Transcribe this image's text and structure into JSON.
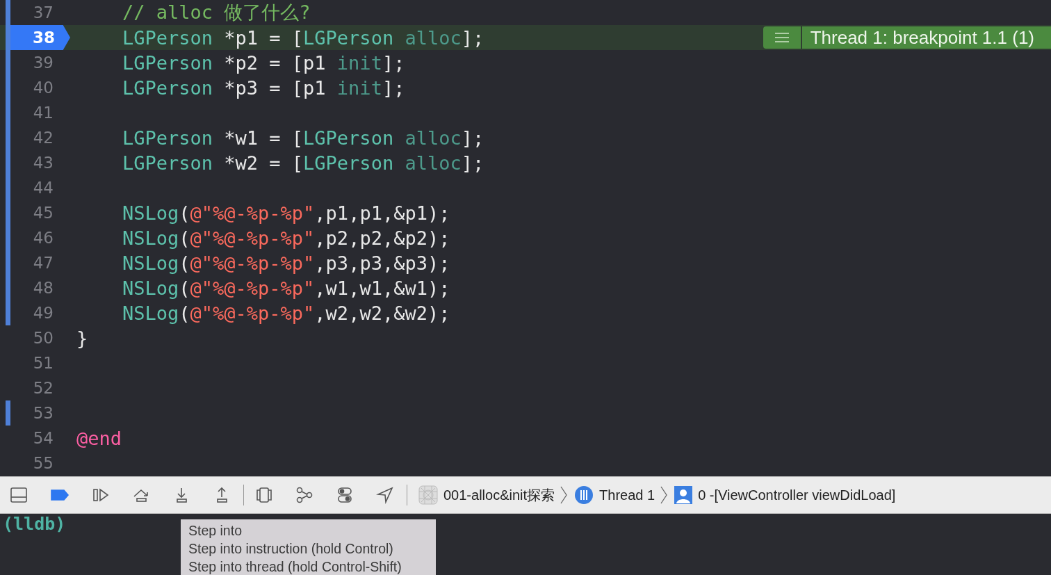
{
  "editor": {
    "lines": [
      {
        "number": "37",
        "current": false,
        "changed": true,
        "indented": true,
        "tokens": [
          {
            "kind": "comment",
            "text": "// alloc 做了什么?"
          }
        ]
      },
      {
        "number": "38",
        "current": true,
        "changed": true,
        "indented": true,
        "tokens": [
          {
            "kind": "type",
            "text": "LGPerson"
          },
          {
            "kind": "plain",
            "text": " *p1 = ["
          },
          {
            "kind": "type",
            "text": "LGPerson"
          },
          {
            "kind": "method",
            "text": " alloc"
          },
          {
            "kind": "plain",
            "text": "];"
          }
        ]
      },
      {
        "number": "39",
        "current": false,
        "changed": true,
        "indented": true,
        "tokens": [
          {
            "kind": "type",
            "text": "LGPerson"
          },
          {
            "kind": "plain",
            "text": " *p2 = [p1 "
          },
          {
            "kind": "method",
            "text": "init"
          },
          {
            "kind": "plain",
            "text": "];"
          }
        ]
      },
      {
        "number": "40",
        "current": false,
        "changed": true,
        "indented": true,
        "tokens": [
          {
            "kind": "type",
            "text": "LGPerson"
          },
          {
            "kind": "plain",
            "text": " *p3 = [p1 "
          },
          {
            "kind": "method",
            "text": "init"
          },
          {
            "kind": "plain",
            "text": "];"
          }
        ]
      },
      {
        "number": "41",
        "current": false,
        "changed": true
      },
      {
        "number": "42",
        "current": false,
        "changed": true,
        "indented": true,
        "tokens": [
          {
            "kind": "type",
            "text": "LGPerson"
          },
          {
            "kind": "plain",
            "text": " *w1 = ["
          },
          {
            "kind": "type",
            "text": "LGPerson"
          },
          {
            "kind": "method",
            "text": " alloc"
          },
          {
            "kind": "plain",
            "text": "];"
          }
        ]
      },
      {
        "number": "43",
        "current": false,
        "changed": true,
        "indented": true,
        "tokens": [
          {
            "kind": "type",
            "text": "LGPerson"
          },
          {
            "kind": "plain",
            "text": " *w2 = ["
          },
          {
            "kind": "type",
            "text": "LGPerson"
          },
          {
            "kind": "method",
            "text": " alloc"
          },
          {
            "kind": "plain",
            "text": "];"
          }
        ]
      },
      {
        "number": "44",
        "current": false,
        "changed": true
      },
      {
        "number": "45",
        "current": false,
        "changed": true,
        "indented": true,
        "tokens": [
          {
            "kind": "type",
            "text": "NSLog"
          },
          {
            "kind": "plain",
            "text": "("
          },
          {
            "kind": "string",
            "text": "@\"%@-%p-%p\""
          },
          {
            "kind": "plain",
            "text": ",p1,p1,&p1);"
          }
        ]
      },
      {
        "number": "46",
        "current": false,
        "changed": true,
        "indented": true,
        "tokens": [
          {
            "kind": "type",
            "text": "NSLog"
          },
          {
            "kind": "plain",
            "text": "("
          },
          {
            "kind": "string",
            "text": "@\"%@-%p-%p\""
          },
          {
            "kind": "plain",
            "text": ",p2,p2,&p2);"
          }
        ]
      },
      {
        "number": "47",
        "current": false,
        "changed": true,
        "indented": true,
        "tokens": [
          {
            "kind": "type",
            "text": "NSLog"
          },
          {
            "kind": "plain",
            "text": "("
          },
          {
            "kind": "string",
            "text": "@\"%@-%p-%p\""
          },
          {
            "kind": "plain",
            "text": ",p3,p3,&p3);"
          }
        ]
      },
      {
        "number": "48",
        "current": false,
        "changed": true,
        "indented": true,
        "tokens": [
          {
            "kind": "type",
            "text": "NSLog"
          },
          {
            "kind": "plain",
            "text": "("
          },
          {
            "kind": "string",
            "text": "@\"%@-%p-%p\""
          },
          {
            "kind": "plain",
            "text": ",w1,w1,&w1);"
          }
        ]
      },
      {
        "number": "49",
        "current": false,
        "changed": true,
        "indented": true,
        "tokens": [
          {
            "kind": "type",
            "text": "NSLog"
          },
          {
            "kind": "plain",
            "text": "("
          },
          {
            "kind": "string",
            "text": "@\"%@-%p-%p\""
          },
          {
            "kind": "plain",
            "text": ",w2,w2,&w2);"
          }
        ]
      },
      {
        "number": "50",
        "current": false,
        "changed": false,
        "indented": false,
        "tokens": [
          {
            "kind": "plain",
            "text": "}"
          }
        ]
      },
      {
        "number": "51",
        "current": false,
        "changed": false
      },
      {
        "number": "52",
        "current": false,
        "changed": false
      },
      {
        "number": "53",
        "current": false,
        "changed": true
      },
      {
        "number": "54",
        "current": false,
        "changed": false,
        "indented": false,
        "tokens": [
          {
            "kind": "keyword",
            "text": "@end"
          }
        ]
      },
      {
        "number": "55",
        "current": false,
        "changed": false
      }
    ],
    "badge": {
      "label": "Thread 1: breakpoint 1.1 (1)"
    }
  },
  "debug_bar": {
    "breakpoints_on": true,
    "breadcrumbs": [
      {
        "kind": "app",
        "label": "001-alloc&init探索"
      },
      {
        "kind": "thread",
        "label": "Thread 1"
      },
      {
        "kind": "frame",
        "label": "0 -[ViewController viewDidLoad]"
      }
    ]
  },
  "console": {
    "prompt": "(lldb)"
  },
  "tooltip": {
    "lines": [
      "Step into",
      "Step into instruction (hold Control)",
      "Step into thread (hold Control-Shift)"
    ]
  }
}
